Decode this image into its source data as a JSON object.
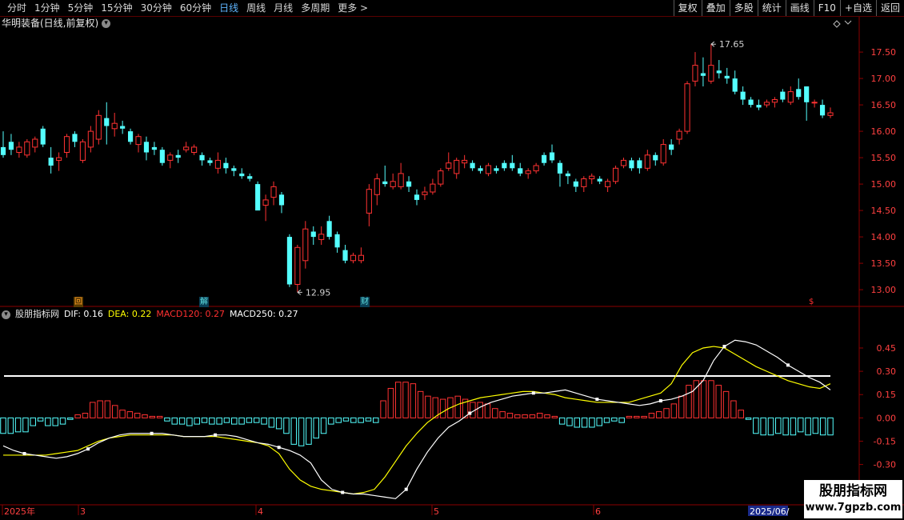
{
  "toolbar": {
    "periods": [
      "分时",
      "1分钟",
      "5分钟",
      "15分钟",
      "30分钟",
      "60分钟",
      "日线",
      "周线",
      "月线",
      "多周期",
      "更多 >"
    ],
    "active_period": "日线",
    "buttons": [
      "复权",
      "叠加",
      "多股",
      "统计",
      "画线",
      "F10",
      "+自选",
      "返回"
    ]
  },
  "stock_title": "华明装备(日线,前复权)",
  "stock_title_icon": "chevron-down-icon",
  "indicator": {
    "name": "股朋指标网",
    "dif_label": "DIF: 0.16",
    "dea_label": "DEA: 0.22",
    "macd120_label": "MACD120: 0.27",
    "macd250_label": "MACD250: 0.27",
    "colors": {
      "dif": "#ffffff",
      "dea": "#ffff00",
      "macd120": "#ff3030",
      "macd250": "#ffffff"
    }
  },
  "markers": [
    {
      "text": "回",
      "color": "#ff9d2b",
      "bg": "#5a3b00"
    },
    {
      "text": "解",
      "color": "#5fe0e0",
      "bg": "#0a3f55"
    },
    {
      "text": "财",
      "color": "#5fe0e0",
      "bg": "#0a3f55"
    },
    {
      "text": "$",
      "color": "#ff3030",
      "bg": "transparent"
    }
  ],
  "watermark": {
    "line1": "股朋指标网",
    "line2": "www.7gpzb.com"
  },
  "x_axis": {
    "labels": [
      "2025年",
      "3",
      "4",
      "5",
      "6"
    ],
    "highlight": "2025/06/"
  },
  "chart_data": [
    {
      "type": "candlestick",
      "title": "华明装备(日线,前复权)",
      "ylim": [
        12.85,
        17.85
      ],
      "yticks": [
        13.0,
        13.5,
        14.0,
        14.5,
        15.0,
        15.5,
        16.0,
        16.5,
        17.0,
        17.5
      ],
      "annotations": [
        {
          "text": "17.65",
          "kind": "max"
        },
        {
          "text": "12.95",
          "kind": "min"
        }
      ],
      "ohlc": [
        [
          15.7,
          16.0,
          15.5,
          15.55
        ],
        [
          15.8,
          15.95,
          15.55,
          15.65
        ],
        [
          15.6,
          15.8,
          15.5,
          15.7
        ],
        [
          15.55,
          15.85,
          15.5,
          15.8
        ],
        [
          15.7,
          15.9,
          15.6,
          15.85
        ],
        [
          16.05,
          16.1,
          15.7,
          15.75
        ],
        [
          15.5,
          15.7,
          15.2,
          15.35
        ],
        [
          15.45,
          15.6,
          15.25,
          15.5
        ],
        [
          15.6,
          15.95,
          15.5,
          15.9
        ],
        [
          15.95,
          16.0,
          15.7,
          15.8
        ],
        [
          15.45,
          15.85,
          15.4,
          15.8
        ],
        [
          15.7,
          16.1,
          15.6,
          16.0
        ],
        [
          15.85,
          16.4,
          15.75,
          16.3
        ],
        [
          16.25,
          16.55,
          15.75,
          16.1
        ],
        [
          16.05,
          16.35,
          15.9,
          16.15
        ],
        [
          16.1,
          16.2,
          15.95,
          16.05
        ],
        [
          16.0,
          16.05,
          15.75,
          15.8
        ],
        [
          15.75,
          15.95,
          15.6,
          15.9
        ],
        [
          15.8,
          15.9,
          15.45,
          15.6
        ],
        [
          15.7,
          15.8,
          15.55,
          15.65
        ],
        [
          15.65,
          15.7,
          15.35,
          15.4
        ],
        [
          15.45,
          15.6,
          15.3,
          15.55
        ],
        [
          15.55,
          15.65,
          15.4,
          15.5
        ],
        [
          15.65,
          15.8,
          15.6,
          15.7
        ],
        [
          15.6,
          15.75,
          15.55,
          15.7
        ],
        [
          15.55,
          15.6,
          15.35,
          15.45
        ],
        [
          15.45,
          15.5,
          15.35,
          15.4
        ],
        [
          15.3,
          15.6,
          15.2,
          15.45
        ],
        [
          15.4,
          15.5,
          15.2,
          15.3
        ],
        [
          15.3,
          15.35,
          15.15,
          15.25
        ],
        [
          15.2,
          15.3,
          15.1,
          15.15
        ],
        [
          15.15,
          15.2,
          15.05,
          15.1
        ],
        [
          15.0,
          15.05,
          14.6,
          14.5
        ],
        [
          14.6,
          14.8,
          14.3,
          14.7
        ],
        [
          14.75,
          15.05,
          14.6,
          14.95
        ],
        [
          14.8,
          14.85,
          14.45,
          14.6
        ],
        [
          14.0,
          14.05,
          13.05,
          13.1
        ],
        [
          13.1,
          13.85,
          12.95,
          13.8
        ],
        [
          13.55,
          14.3,
          13.4,
          14.15
        ],
        [
          14.1,
          14.2,
          13.85,
          14.0
        ],
        [
          13.95,
          14.2,
          13.85,
          14.05
        ],
        [
          14.3,
          14.4,
          13.95,
          14.0
        ],
        [
          14.05,
          14.1,
          13.7,
          13.8
        ],
        [
          13.75,
          13.85,
          13.5,
          13.55
        ],
        [
          13.55,
          13.7,
          13.5,
          13.65
        ],
        [
          13.55,
          13.8,
          13.5,
          13.65
        ],
        [
          14.45,
          15.0,
          14.2,
          14.9
        ],
        [
          14.8,
          15.2,
          14.6,
          15.1
        ],
        [
          15.05,
          15.35,
          14.95,
          15.0
        ],
        [
          14.95,
          15.2,
          14.9,
          15.05
        ],
        [
          14.95,
          15.4,
          14.9,
          15.2
        ],
        [
          15.05,
          15.15,
          14.85,
          14.95
        ],
        [
          14.8,
          14.9,
          14.6,
          14.7
        ],
        [
          14.8,
          14.95,
          14.7,
          14.85
        ],
        [
          14.85,
          15.1,
          14.8,
          15.0
        ],
        [
          15.0,
          15.3,
          14.95,
          15.25
        ],
        [
          15.3,
          15.6,
          15.25,
          15.4
        ],
        [
          15.2,
          15.5,
          15.1,
          15.45
        ],
        [
          15.4,
          15.55,
          15.3,
          15.45
        ],
        [
          15.4,
          15.45,
          15.25,
          15.3
        ],
        [
          15.3,
          15.35,
          15.2,
          15.25
        ],
        [
          15.2,
          15.4,
          15.15,
          15.35
        ],
        [
          15.3,
          15.35,
          15.2,
          15.25
        ],
        [
          15.4,
          15.45,
          15.25,
          15.3
        ],
        [
          15.4,
          15.55,
          15.25,
          15.3
        ],
        [
          15.3,
          15.4,
          15.15,
          15.2
        ],
        [
          15.2,
          15.3,
          15.1,
          15.25
        ],
        [
          15.25,
          15.4,
          15.2,
          15.35
        ],
        [
          15.55,
          15.6,
          15.35,
          15.4
        ],
        [
          15.6,
          15.75,
          15.4,
          15.45
        ],
        [
          15.4,
          15.45,
          14.95,
          15.2
        ],
        [
          15.2,
          15.25,
          15.0,
          15.15
        ],
        [
          15.05,
          15.1,
          14.85,
          14.95
        ],
        [
          14.95,
          15.15,
          14.85,
          15.1
        ],
        [
          15.1,
          15.2,
          15.0,
          15.15
        ],
        [
          15.1,
          15.15,
          15.0,
          15.05
        ],
        [
          14.95,
          15.1,
          14.85,
          15.05
        ],
        [
          15.05,
          15.35,
          15.0,
          15.3
        ],
        [
          15.35,
          15.5,
          15.3,
          15.45
        ],
        [
          15.45,
          15.5,
          15.25,
          15.3
        ],
        [
          15.45,
          15.5,
          15.2,
          15.3
        ],
        [
          15.3,
          15.65,
          15.25,
          15.55
        ],
        [
          15.55,
          15.6,
          15.35,
          15.45
        ],
        [
          15.4,
          15.85,
          15.35,
          15.75
        ],
        [
          15.75,
          15.85,
          15.55,
          15.65
        ],
        [
          15.85,
          16.05,
          15.75,
          16.0
        ],
        [
          16.0,
          16.95,
          15.95,
          16.9
        ],
        [
          16.95,
          17.5,
          16.85,
          17.25
        ],
        [
          17.1,
          17.4,
          16.85,
          17.05
        ],
        [
          16.95,
          17.65,
          16.9,
          17.25
        ],
        [
          17.15,
          17.35,
          17.0,
          17.1
        ],
        [
          17.05,
          17.2,
          16.9,
          17.0
        ],
        [
          17.0,
          17.15,
          16.7,
          16.75
        ],
        [
          16.75,
          16.85,
          16.5,
          16.6
        ],
        [
          16.6,
          16.65,
          16.45,
          16.5
        ],
        [
          16.5,
          16.6,
          16.4,
          16.45
        ],
        [
          16.5,
          16.6,
          16.45,
          16.55
        ],
        [
          16.55,
          16.65,
          16.45,
          16.6
        ],
        [
          16.75,
          16.8,
          16.55,
          16.6
        ],
        [
          16.55,
          16.85,
          16.5,
          16.75
        ],
        [
          16.8,
          17.0,
          16.6,
          16.65
        ],
        [
          16.85,
          16.85,
          16.2,
          16.55
        ],
        [
          16.55,
          16.6,
          16.45,
          16.55
        ],
        [
          16.5,
          16.6,
          16.25,
          16.3
        ],
        [
          16.3,
          16.45,
          16.25,
          16.35
        ]
      ]
    },
    {
      "type": "macd",
      "ylim": [
        -0.4,
        0.62
      ],
      "yticks": [
        0.45,
        0.3,
        0.15,
        0.0,
        -0.15,
        -0.3
      ],
      "reference_line": 0.27,
      "series": [
        {
          "name": "DIF",
          "color": "#ffffff",
          "values": [
            -0.18,
            -0.21,
            -0.23,
            -0.24,
            -0.25,
            -0.26,
            -0.25,
            -0.23,
            -0.2,
            -0.16,
            -0.13,
            -0.11,
            -0.1,
            -0.1,
            -0.1,
            -0.1,
            -0.11,
            -0.12,
            -0.12,
            -0.12,
            -0.11,
            -0.11,
            -0.12,
            -0.14,
            -0.16,
            -0.17,
            -0.19,
            -0.21,
            -0.24,
            -0.29,
            -0.4,
            -0.46,
            -0.48,
            -0.49,
            -0.49,
            -0.5,
            -0.51,
            -0.52,
            -0.46,
            -0.33,
            -0.22,
            -0.13,
            -0.06,
            -0.02,
            0.03,
            0.07,
            0.1,
            0.12,
            0.14,
            0.15,
            0.16,
            0.16,
            0.17,
            0.18,
            0.16,
            0.14,
            0.12,
            0.11,
            0.1,
            0.09,
            0.08,
            0.09,
            0.11,
            0.12,
            0.14,
            0.17,
            0.24,
            0.37,
            0.46,
            0.5,
            0.49,
            0.47,
            0.43,
            0.39,
            0.34,
            0.3,
            0.26,
            0.23,
            0.18
          ]
        },
        {
          "name": "DEA",
          "color": "#ffff00",
          "values": [
            -0.24,
            -0.24,
            -0.24,
            -0.24,
            -0.24,
            -0.23,
            -0.22,
            -0.21,
            -0.18,
            -0.15,
            -0.13,
            -0.12,
            -0.11,
            -0.11,
            -0.11,
            -0.11,
            -0.11,
            -0.12,
            -0.12,
            -0.12,
            -0.12,
            -0.13,
            -0.14,
            -0.15,
            -0.16,
            -0.18,
            -0.23,
            -0.33,
            -0.4,
            -0.44,
            -0.46,
            -0.47,
            -0.48,
            -0.49,
            -0.48,
            -0.46,
            -0.38,
            -0.28,
            -0.18,
            -0.1,
            -0.03,
            0.02,
            0.06,
            0.09,
            0.11,
            0.13,
            0.14,
            0.15,
            0.16,
            0.17,
            0.17,
            0.16,
            0.15,
            0.13,
            0.12,
            0.11,
            0.1,
            0.1,
            0.1,
            0.1,
            0.12,
            0.14,
            0.16,
            0.22,
            0.34,
            0.42,
            0.45,
            0.46,
            0.45,
            0.41,
            0.37,
            0.33,
            0.3,
            0.27,
            0.24,
            0.22,
            0.2,
            0.19,
            0.22
          ]
        },
        {
          "name": "MACD",
          "values": [
            -0.1,
            -0.1,
            -0.09,
            -0.09,
            -0.05,
            -0.02,
            -0.05,
            -0.05,
            -0.04,
            -0.01,
            0.02,
            0.03,
            0.1,
            0.11,
            0.11,
            0.08,
            0.05,
            0.04,
            0.03,
            0.02,
            0.01,
            0.01,
            -0.02,
            -0.04,
            -0.04,
            -0.05,
            -0.04,
            -0.03,
            -0.04,
            -0.04,
            -0.03,
            -0.04,
            -0.04,
            -0.03,
            -0.03,
            -0.04,
            -0.06,
            -0.07,
            -0.1,
            -0.17,
            -0.18,
            -0.17,
            -0.13,
            -0.1,
            -0.04,
            -0.03,
            -0.02,
            -0.03,
            -0.03,
            -0.02,
            -0.03,
            0.11,
            0.19,
            0.23,
            0.23,
            0.22,
            0.17,
            0.14,
            0.13,
            0.12,
            0.13,
            0.14,
            0.12,
            0.1,
            0.1,
            0.09,
            0.06,
            0.04,
            0.03,
            0.02,
            0.02,
            0.02,
            0.03,
            0.02,
            0.01,
            -0.04,
            -0.05,
            -0.06,
            -0.06,
            -0.06,
            -0.05,
            -0.03,
            -0.02,
            -0.03,
            0.01,
            0.01,
            0.01,
            0.03,
            0.04,
            0.06,
            0.09,
            0.14,
            0.21,
            0.24,
            0.24,
            0.24,
            0.21,
            0.17,
            0.11,
            0.05,
            -0.01,
            -0.1,
            -0.11,
            -0.11,
            -0.1,
            -0.11,
            -0.11,
            -0.09,
            -0.11,
            -0.1,
            -0.11,
            -0.11
          ]
        }
      ]
    }
  ]
}
